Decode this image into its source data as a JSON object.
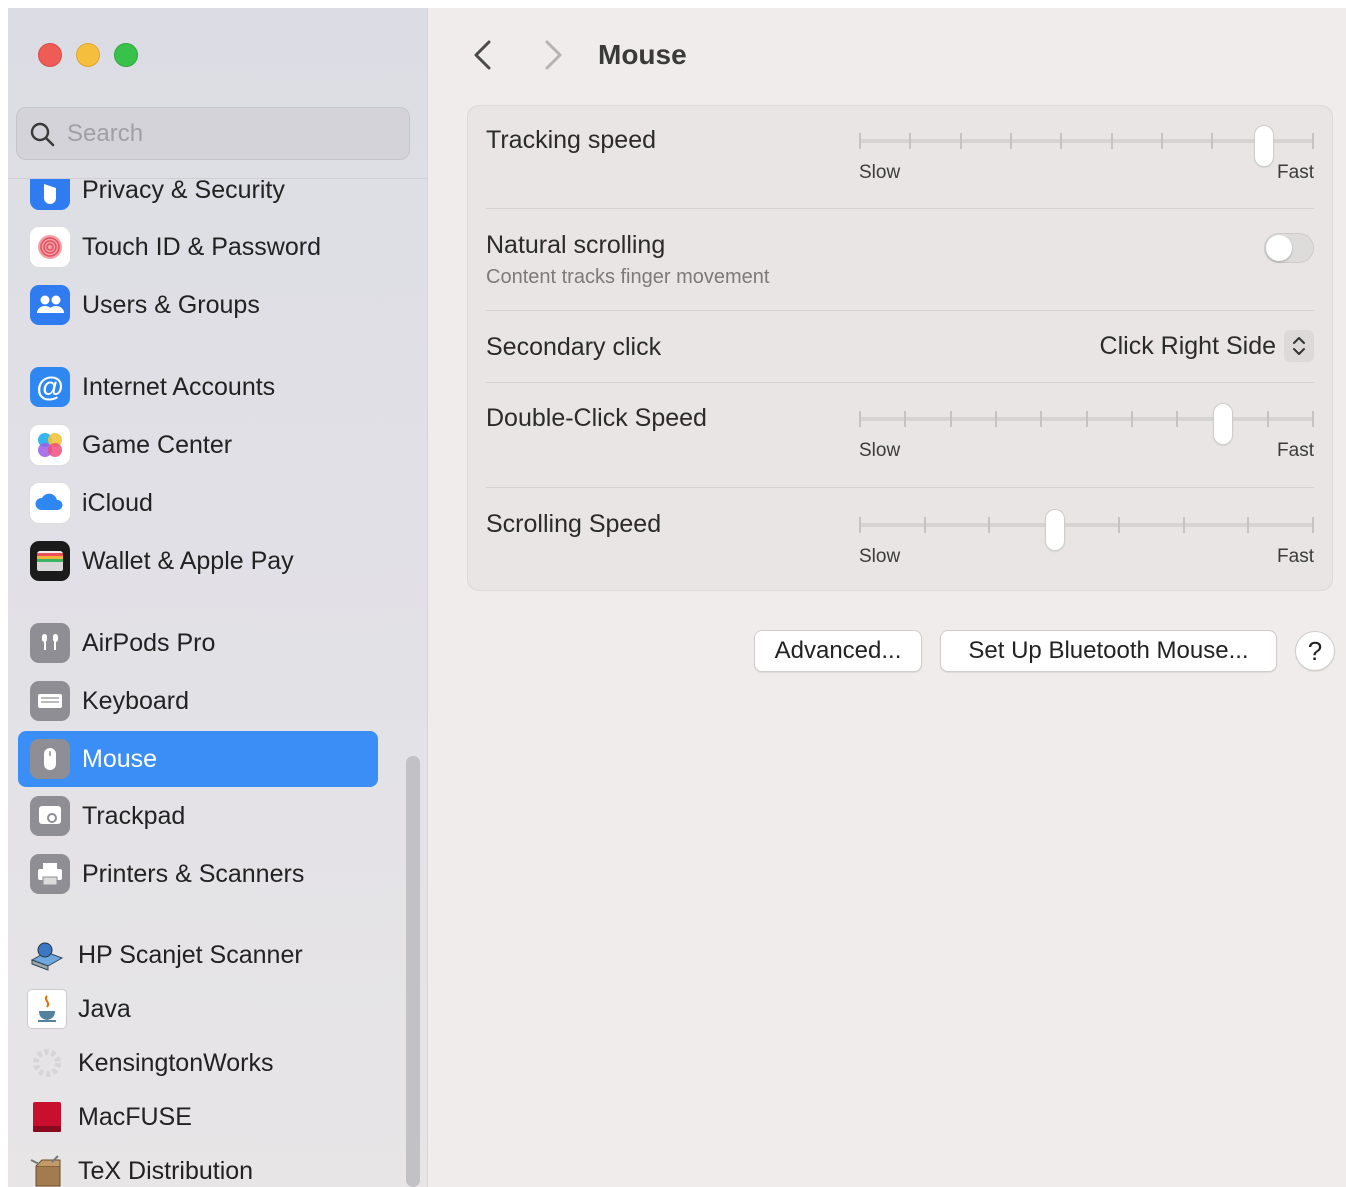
{
  "search": {
    "placeholder": "Search"
  },
  "sidebar": {
    "items": [
      {
        "label": "Privacy & Security"
      },
      {
        "label": "Touch ID & Password"
      },
      {
        "label": "Users & Groups"
      },
      {
        "label": "Internet Accounts"
      },
      {
        "label": "Game Center"
      },
      {
        "label": "iCloud"
      },
      {
        "label": "Wallet & Apple Pay"
      },
      {
        "label": "AirPods Pro"
      },
      {
        "label": "Keyboard"
      },
      {
        "label": "Mouse",
        "selected": true
      },
      {
        "label": "Trackpad"
      },
      {
        "label": "Printers & Scanners"
      },
      {
        "label": "HP Scanjet Scanner"
      },
      {
        "label": "Java"
      },
      {
        "label": "KensingtonWorks"
      },
      {
        "label": "MacFUSE"
      },
      {
        "label": "TeX Distribution"
      }
    ]
  },
  "header": {
    "title": "Mouse"
  },
  "settings": {
    "tracking_speed": {
      "label": "Tracking speed",
      "slow": "Slow",
      "fast": "Fast",
      "ticks": 10,
      "position": 0.89
    },
    "natural_scrolling": {
      "label": "Natural scrolling",
      "description": "Content tracks finger movement",
      "enabled": false
    },
    "secondary_click": {
      "label": "Secondary click",
      "value": "Click Right Side"
    },
    "double_click_speed": {
      "label": "Double-Click Speed",
      "slow": "Slow",
      "fast": "Fast",
      "ticks": 11,
      "position": 0.8
    },
    "scrolling_speed": {
      "label": "Scrolling Speed",
      "slow": "Slow",
      "fast": "Fast",
      "ticks": 8,
      "position": 0.43
    }
  },
  "buttons": {
    "advanced": "Advanced...",
    "bluetooth": "Set Up Bluetooth Mouse...",
    "help": "?"
  },
  "colors": {
    "accent": "#3b8ef5",
    "window_bg": "#efeceb",
    "panel_bg": "#e8e5e4"
  }
}
